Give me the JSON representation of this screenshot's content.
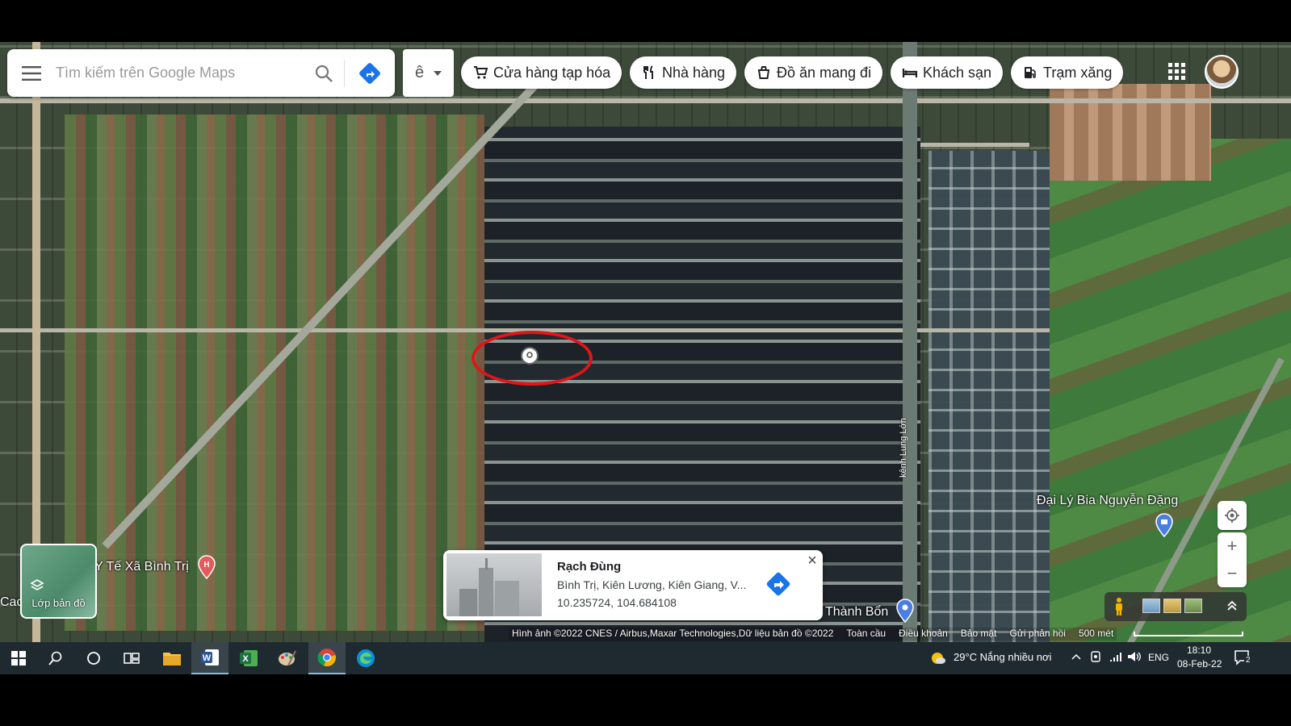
{
  "search": {
    "placeholder": "Tìm kiếm trên Google Maps"
  },
  "ime": {
    "label": "ê"
  },
  "chips": [
    {
      "label": "Cửa hàng tạp hóa",
      "icon": "cart-icon"
    },
    {
      "label": "Nhà hàng",
      "icon": "fork-knife-icon"
    },
    {
      "label": "Đồ ăn mang đi",
      "icon": "takeout-icon"
    },
    {
      "label": "Khách sạn",
      "icon": "bed-icon"
    },
    {
      "label": "Trạm xăng",
      "icon": "gas-pump-icon"
    }
  ],
  "map_labels": {
    "canal": "kênh Lung Lớn",
    "beer_agent": "Đại Lý Bia Nguyễn Đặng",
    "health_station": "Y Tế Xã Bình Trị",
    "left_edge": "Cac",
    "thanh_bon": "Thành Bổn"
  },
  "layers": {
    "label": "Lớp bản đồ"
  },
  "card": {
    "title": "Rạch Đùng",
    "address": "Bình Trị, Kiên Lương, Kiên Giang, V...",
    "coords": "10.235724, 104.684108"
  },
  "attribution": {
    "imagery": "Hình ảnh ©2022 CNES / Airbus,Maxar Technologies,Dữ liệu bản đồ ©2022",
    "globe": "Toàn cầu",
    "terms": "Điều khoản",
    "privacy": "Bảo mật",
    "feedback": "Gửi phản hồi",
    "scale": "500 mét"
  },
  "taskbar": {
    "weather": "29°C  Nắng nhiều nơi",
    "lang": "ENG",
    "time": "18:10",
    "date": "08-Feb-22",
    "notifications": "2"
  },
  "colors": {
    "accent": "#1a73e8",
    "highlight": "#e0151a",
    "taskbar": "#1f2a30"
  }
}
